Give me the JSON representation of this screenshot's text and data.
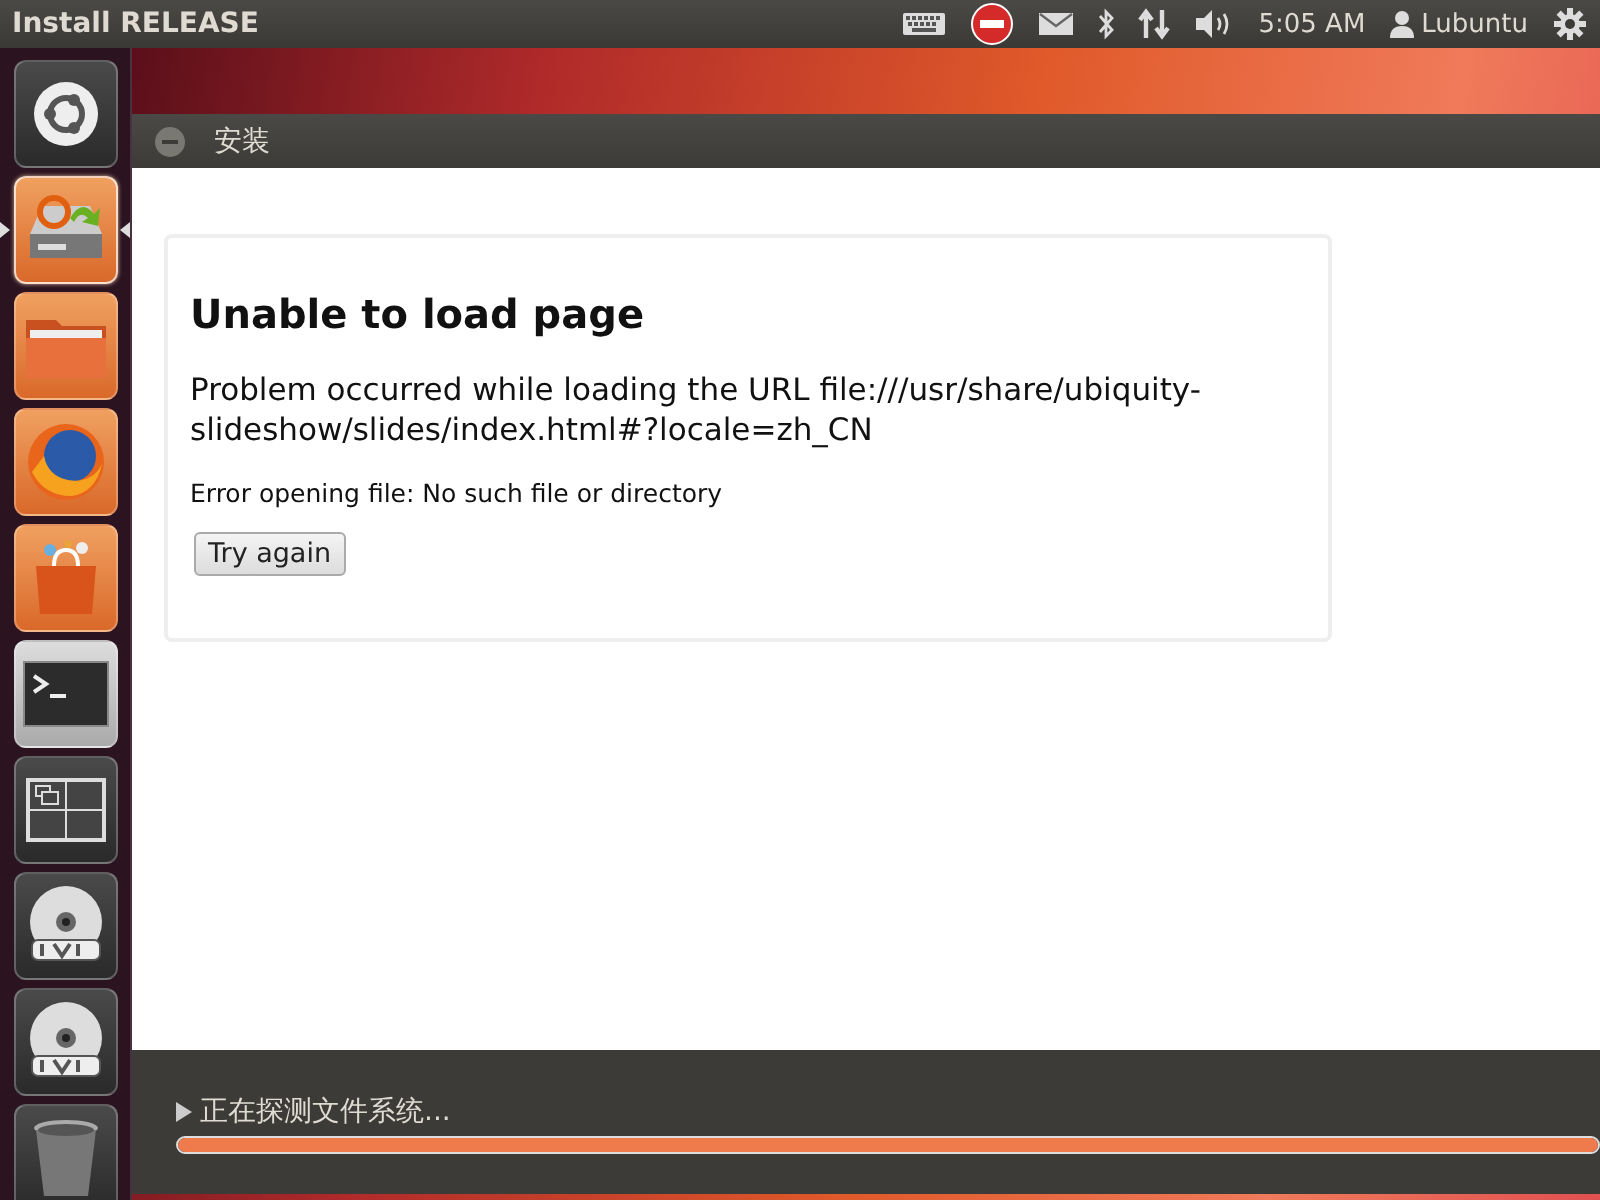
{
  "panel": {
    "title": "Install RELEASE",
    "clock": "5:05 AM",
    "user": "Lubuntu"
  },
  "launcher": [
    {
      "kind": "dash",
      "active": false
    },
    {
      "kind": "installer",
      "active": true
    },
    {
      "kind": "files",
      "active": false
    },
    {
      "kind": "browser",
      "active": false
    },
    {
      "kind": "store",
      "active": false
    },
    {
      "kind": "terminal",
      "active": false
    },
    {
      "kind": "workspaces",
      "active": false
    },
    {
      "kind": "dvd",
      "active": false
    },
    {
      "kind": "dvd",
      "active": false
    },
    {
      "kind": "trash",
      "active": false
    }
  ],
  "window": {
    "title": "安装"
  },
  "error": {
    "heading": "Unable to load page",
    "message": "Problem occurred while loading the URL file:///usr/share/ubiquity-slideshow/slides/index.html#?locale=zh_CN",
    "detail": "Error opening file: No such file or directory",
    "button": "Try again"
  },
  "status": {
    "text": "正在探测文件系统...",
    "expanded": false,
    "level": 1
  }
}
